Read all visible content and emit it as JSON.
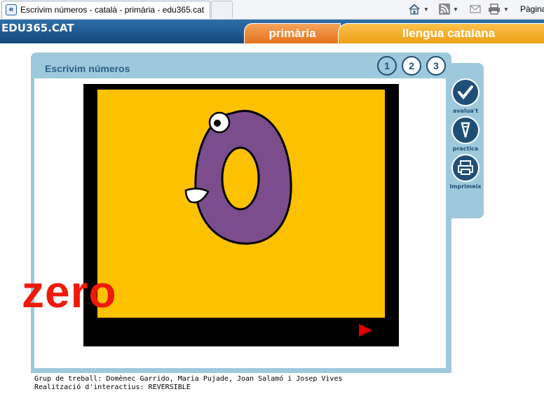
{
  "browser": {
    "tab_title": "Escrivim números - català - primària - edu365.cat",
    "pagina_label": "Pàgina"
  },
  "site": {
    "logo_text": "EDU365.CAT",
    "tab_primaria": "primària",
    "tab_lengua": "llengua catalana"
  },
  "activity": {
    "title": "Escrivim números",
    "steps": [
      "1",
      "2",
      "3"
    ],
    "number_word": "zero",
    "side_buttons": [
      "avalua't",
      "practica",
      "imprimeix"
    ]
  },
  "credits": {
    "line1": "Grup de treball: Domènec Garrido, Maria Pujade, Joan Salamó i Josep Vives",
    "line2": "Realització d'interactius: REVERSIBLE"
  },
  "colors": {
    "header_blue": "#13487a",
    "frame_blue": "#9ec9dc",
    "stage_yellow": "#fcc100",
    "word_red": "#ef1a0c",
    "figure_purple": "#7b4d8c"
  }
}
